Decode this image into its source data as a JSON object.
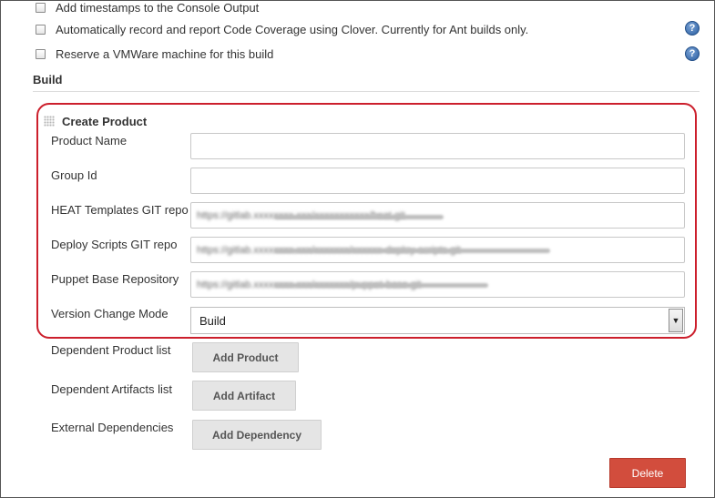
{
  "options": [
    {
      "label": "Add timestamps to the Console Output",
      "has_help": false
    },
    {
      "label": "Automatically record and report Code Coverage using Clover. Currently for Ant builds only.",
      "has_help": true
    },
    {
      "label": "Reserve a VMWare machine for this build",
      "has_help": true
    }
  ],
  "help_glyph": "?",
  "build_section": {
    "title": "Build",
    "block": {
      "title": "Create Product",
      "fields": [
        {
          "label": "Product Name",
          "value": ""
        },
        {
          "label": "Group Id",
          "value": ""
        },
        {
          "label": "HEAT Templates GIT repo",
          "value": "https://gitlab.xxxxxxxx.xxx/xxxxxxxxxxx/heat.git"
        },
        {
          "label": "Deploy Scripts GIT repo",
          "value": "https://gitlab.xxxxxxxx.xxx/xxxxxxx/xxxxxx-deploy-scripts.git"
        },
        {
          "label": "Puppet Base Repository",
          "value": "https://gitlab.xxxxxxxx.xxx/xxxxxxx/puppet-base.git"
        }
      ],
      "version_change_mode": {
        "label": "Version Change Mode",
        "selected": "Build",
        "arrow_glyph": "▼"
      }
    },
    "dependent_products": {
      "label": "Dependent Product list",
      "button": "Add Product"
    },
    "dependent_artifacts": {
      "label": "Dependent Artifacts list",
      "button": "Add Artifact"
    },
    "external_dependencies": {
      "label": "External Dependencies",
      "button": "Add Dependency"
    },
    "delete_button": "Delete"
  },
  "colors": {
    "highlight": "#cc1f2c",
    "delete": "#d24d3d",
    "help_icon": "#2a5da0"
  }
}
